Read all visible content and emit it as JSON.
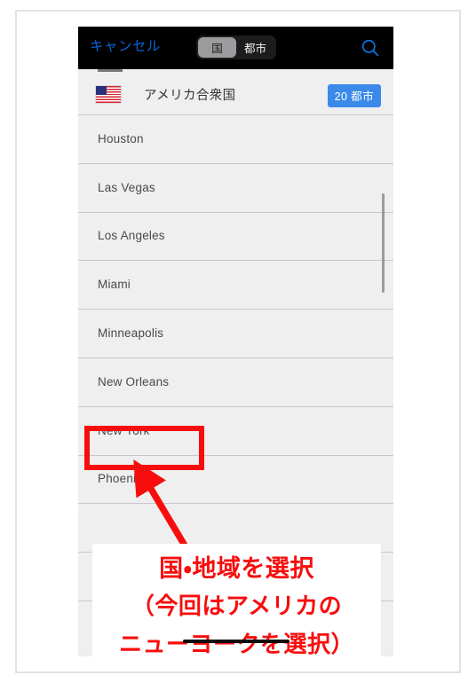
{
  "navbar": {
    "cancel_label": "キャンセル",
    "segments": [
      {
        "label": "国",
        "selected": true
      },
      {
        "label": "都市",
        "selected": false
      }
    ],
    "search_icon": "search-icon",
    "background_color": "#000000",
    "tint_color": "#0a63d6"
  },
  "country_row": {
    "flag_icon": "us-flag-icon",
    "name": "アメリカ合衆国",
    "badge": "20 都市",
    "badge_color": "#3b8aea"
  },
  "cities": [
    {
      "name": "Houston"
    },
    {
      "name": "Las Vegas"
    },
    {
      "name": "Los Angeles"
    },
    {
      "name": "Miami"
    },
    {
      "name": "Minneapolis"
    },
    {
      "name": "New Orleans"
    },
    {
      "name": "New York",
      "highlighted": true
    },
    {
      "name": "Phoenix"
    }
  ],
  "annotation": {
    "highlight_color": "#f70d0d",
    "caption_lines": [
      "国・地域を選択",
      "（今回はアメリカの",
      "ニューヨークを選択）"
    ]
  }
}
